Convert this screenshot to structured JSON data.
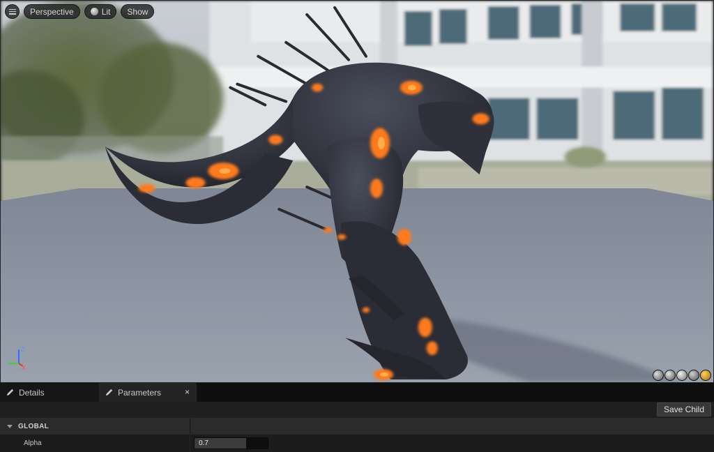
{
  "viewport": {
    "menu_icon": "hamburger-icon",
    "perspective_label": "Perspective",
    "lit_label": "Lit",
    "show_label": "Show",
    "axis": {
      "z": "Z",
      "y": "Y",
      "x": "X"
    },
    "preview_shapes": [
      "cylinder",
      "sphere",
      "plane",
      "cube",
      "custom-mesh"
    ]
  },
  "tabs": [
    {
      "label": "Details",
      "icon": "pencil-icon",
      "active": false
    },
    {
      "label": "Parameters",
      "icon": "pencil-icon",
      "active": true,
      "close": "×"
    }
  ],
  "panel": {
    "save_child_label": "Save Child",
    "category_label": "GLOBAL",
    "params": [
      {
        "name": "Alpha",
        "value": "0.7",
        "fraction": 0.7
      }
    ]
  },
  "colors": {
    "lava_glow": "#ff7a1c",
    "creature_body": "#2a2c36",
    "floor": "#8e96a4",
    "panel_bg": "#1a1a1a"
  }
}
